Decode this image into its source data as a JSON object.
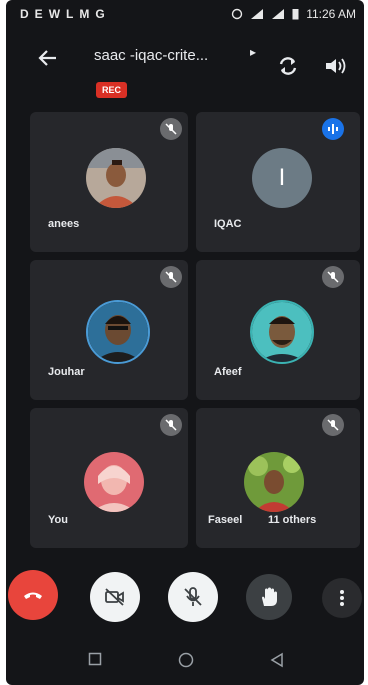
{
  "status_bar": {
    "left_icons": [
      "D",
      "E",
      "W",
      "L",
      "M",
      "G"
    ],
    "time": "11:26 AM"
  },
  "meeting": {
    "title": "saac -iqac-crite...",
    "rec_badge": "REC"
  },
  "participants": [
    {
      "name": "anees",
      "state": "muted",
      "avatar": "photo"
    },
    {
      "name": "IQAC",
      "state": "speaking",
      "avatar": "letter",
      "letter": "I"
    },
    {
      "name": "Jouhar",
      "state": "muted",
      "avatar": "photo"
    },
    {
      "name": "Afeef",
      "state": "muted",
      "avatar": "photo"
    },
    {
      "name": "You",
      "state": "muted",
      "avatar": "photo"
    },
    {
      "name": "Faseel",
      "state": "muted",
      "avatar": "photo"
    }
  ],
  "others_label": "11 others",
  "colors": {
    "background": "#141518",
    "tile": "#26272b",
    "end_call": "#e8453c",
    "speaking": "#1a73e8",
    "rec": "#d93025"
  },
  "icons": {
    "back": "arrow-left-icon",
    "flip_camera": "flip-camera-icon",
    "speaker": "speaker-icon",
    "end_call": "phone-hangup-icon",
    "camera_off": "camera-off-icon",
    "mic_off": "mic-off-icon",
    "raise_hand": "hand-icon",
    "more": "more-vert-icon"
  }
}
